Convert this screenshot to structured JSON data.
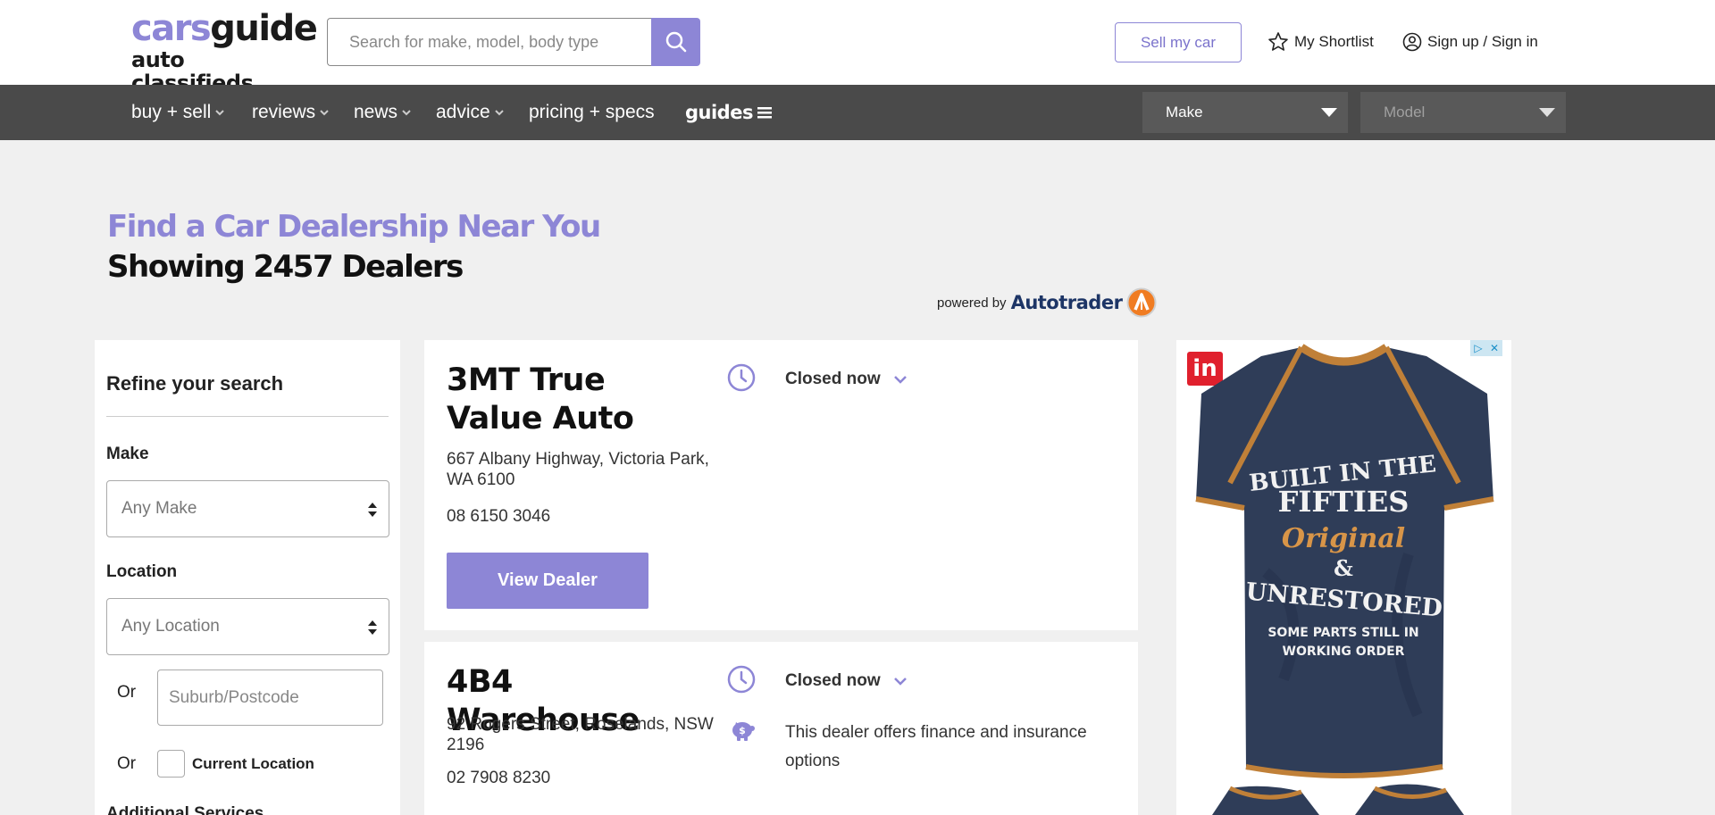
{
  "header": {
    "logo_line1_a": "cars",
    "logo_line1_b": "guide",
    "logo_line2": "auto classifieds",
    "search_placeholder": "Search for make, model, body type",
    "sell_label": "Sell my car",
    "shortlist_label": "My Shortlist",
    "signin_label": "Sign up / Sign in"
  },
  "nav": {
    "items": [
      "buy + sell",
      "reviews",
      "news",
      "advice",
      "pricing + specs",
      "guides"
    ],
    "make_select": "Make",
    "model_select": "Model"
  },
  "page": {
    "title": "Find a Car Dealership Near You",
    "count_text": "Showing 2457 Dealers",
    "powered_by": "powered by",
    "powered_brand": "Autotrader"
  },
  "sidebar": {
    "title": "Refine your search",
    "make_label": "Make",
    "make_value": "Any Make",
    "location_label": "Location",
    "location_value": "Any Location",
    "or1": "Or",
    "suburb_placeholder": "Suburb/Postcode",
    "or2": "Or",
    "current_location": "Current Location",
    "next_section": "Additional Services"
  },
  "dealers": [
    {
      "name": "3MT True Value Auto",
      "address": "667 Albany Highway, Victoria Park, WA 6100",
      "phone": "08 6150 3046",
      "status": "Closed now",
      "button": "View Dealer"
    },
    {
      "name": "4B4 Warehouse",
      "address": "92 Rogers Street, Roselands, NSW 2196",
      "phone": "02 7908 8230",
      "status": "Closed now",
      "finance": "This dealer offers finance and insurance options"
    }
  ],
  "ad": {
    "brand_badge": "in",
    "shirt_line1": "BUILT IN THE",
    "shirt_line2": "FIFTIES",
    "shirt_line3": "Original",
    "shirt_line4": "&",
    "shirt_line5": "UNRESTORED",
    "shirt_line6": "SOME PARTS STILL IN",
    "shirt_line7": "WORKING ORDER"
  },
  "colors": {
    "brand_purple": "#8d86d6",
    "nav_bg": "#4a4a4a",
    "page_bg": "#f0f0f0"
  }
}
